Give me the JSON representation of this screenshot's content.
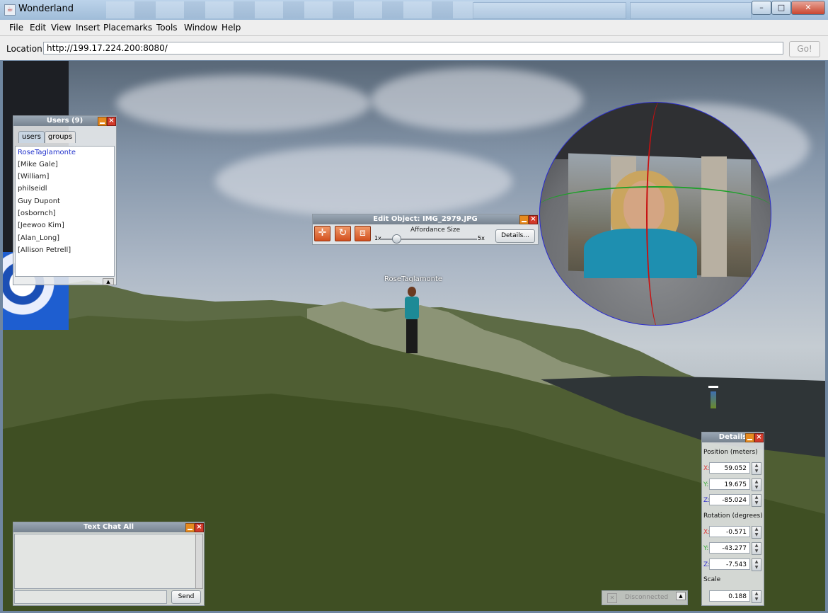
{
  "window": {
    "title": "Wonderland",
    "controls": {
      "minimize": "–",
      "maximize": "□",
      "close": "✕"
    }
  },
  "menu": {
    "items": [
      "File",
      "Edit",
      "View",
      "Insert",
      "Placemarks",
      "Tools",
      "Window",
      "Help"
    ]
  },
  "location": {
    "label": "Location:",
    "url": "http://199.17.224.200:8080/",
    "go_label": "Go!"
  },
  "users_panel": {
    "title": "Users (9)",
    "tabs": [
      "users",
      "groups"
    ],
    "users": [
      "RoseTaglamonte",
      "[Mike Gale]",
      "[William]",
      "philseidl",
      "Guy Dupont",
      "[osbornch]",
      "[Jeewoo Kim]",
      "[Alan_Long]",
      "[Allison Petrell]"
    ]
  },
  "edit_object": {
    "title": "Edit Object: IMG_2979.JPG",
    "affordance_label": "Affordance Size",
    "min_label": "1x",
    "max_label": "5x",
    "affordance_value": 1.5,
    "details_button": "Details..."
  },
  "avatar": {
    "name": "RoseTaglamonte"
  },
  "details_panel": {
    "title": "Details",
    "position_label": "Position (meters)",
    "rotation_label": "Rotation (degrees)",
    "scale_label": "Scale",
    "axes": [
      "X:",
      "Y:",
      "Z:"
    ],
    "position": [
      "59.052",
      "19.675",
      "-85.024"
    ],
    "rotation": [
      "-0.571",
      "-43.277",
      "-7.543"
    ],
    "scale": "0.188"
  },
  "chat": {
    "title": "Text Chat All",
    "send_label": "Send"
  },
  "status": {
    "text": "Disconnected"
  },
  "colors": {
    "hud_title": "#76828f",
    "accent_orange": "#e68a1f",
    "close_red": "#d23a2a",
    "active_user": "#2233cc"
  }
}
